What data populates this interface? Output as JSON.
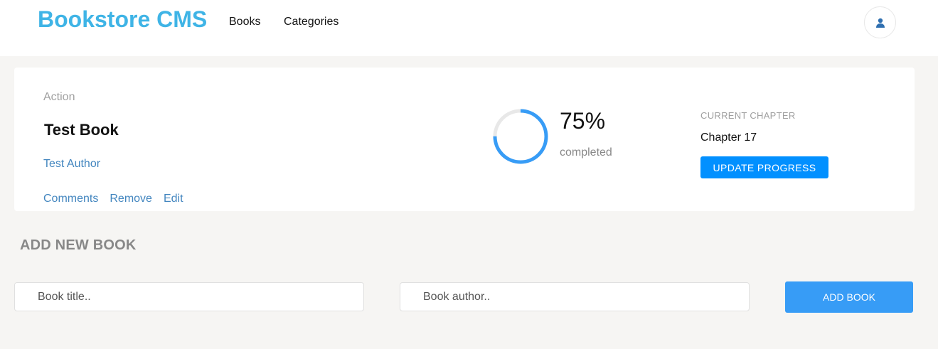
{
  "header": {
    "logo": "Bookstore CMS",
    "nav": [
      "Books",
      "Categories"
    ],
    "user_icon": "user-icon"
  },
  "book": {
    "genre": "Action",
    "title": "Test Book",
    "author": "Test Author",
    "actions": [
      "Comments",
      "Remove",
      "Edit"
    ],
    "progress_percent": 75,
    "progress_label": "75%",
    "completed_label": "completed",
    "current_chapter_label": "CURRENT CHAPTER",
    "current_chapter": "Chapter 17",
    "update_button": "UPDATE PROGRESS"
  },
  "add_form": {
    "heading": "ADD NEW BOOK",
    "title_placeholder": "Book title..",
    "author_placeholder": "Book author..",
    "submit": "ADD BOOK"
  },
  "colors": {
    "logo": "#3fb4e6",
    "link": "#4386bf",
    "progress": "#379cf6",
    "progress_track": "#e8e8e8",
    "primary_button": "#0290ff"
  }
}
